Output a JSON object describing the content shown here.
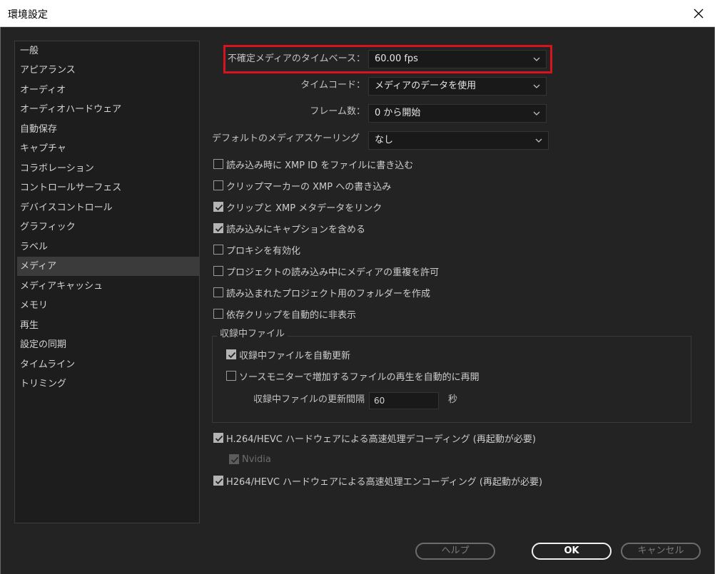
{
  "window": {
    "title": "環境設定"
  },
  "sidebar": {
    "items": [
      {
        "label": "一般"
      },
      {
        "label": "アピアランス"
      },
      {
        "label": "オーディオ"
      },
      {
        "label": "オーディオハードウェア"
      },
      {
        "label": "自動保存"
      },
      {
        "label": "キャプチャ"
      },
      {
        "label": "コラボレーション"
      },
      {
        "label": "コントロールサーフェス"
      },
      {
        "label": "デバイスコントロール"
      },
      {
        "label": "グラフィック"
      },
      {
        "label": "ラベル"
      },
      {
        "label": "メディア",
        "selected": true
      },
      {
        "label": "メディアキャッシュ"
      },
      {
        "label": "メモリ"
      },
      {
        "label": "再生"
      },
      {
        "label": "設定の同期"
      },
      {
        "label": "タイムライン"
      },
      {
        "label": "トリミング"
      }
    ]
  },
  "media": {
    "timebase": {
      "label": "不確定メディアのタイムベース：",
      "value": "60.00 fps"
    },
    "timecode": {
      "label": "タイムコード：",
      "value": "メディアのデータを使用"
    },
    "frame_count": {
      "label": "フレーム数：",
      "value": "0 から開始"
    },
    "scaling": {
      "label": "デフォルトのメディアスケーリング",
      "value": "なし"
    },
    "checkboxes": [
      {
        "label": "読み込み時に XMP ID をファイルに書き込む",
        "checked": false
      },
      {
        "label": "クリップマーカーの XMP への書き込み",
        "checked": false
      },
      {
        "label": "クリップと XMP メタデータをリンク",
        "checked": true
      },
      {
        "label": "読み込みにキャプションを含める",
        "checked": true
      },
      {
        "label": "プロキシを有効化",
        "checked": false
      },
      {
        "label": "プロジェクトの読み込み中にメディアの重複を許可",
        "checked": false
      },
      {
        "label": "読み込まれたプロジェクト用のフォルダーを作成",
        "checked": false
      },
      {
        "label": "依存クリップを自動的に非表示",
        "checked": false
      }
    ],
    "growing": {
      "title": "収録中ファイル",
      "auto_refresh": {
        "label": "収録中ファイルを自動更新",
        "checked": true
      },
      "resume_playback": {
        "label": "ソースモニターで増加するファイルの再生を自動的に再開",
        "checked": false
      },
      "interval_label": "収録中ファイルの更新間隔",
      "interval_value": "60",
      "interval_unit": "秒"
    },
    "hw_decode": {
      "label": "H.264/HEVC ハードウェアによる高速処理デコーディング (再起動が必要)",
      "checked": true
    },
    "nvidia": {
      "label": "Nvidia",
      "checked": true,
      "disabled": true
    },
    "hw_encode": {
      "label": "H264/HEVC ハードウェアによる高速処理エンコーディング (再起動が必要)",
      "checked": true
    }
  },
  "buttons": {
    "help": "ヘルプ",
    "ok": "OK",
    "cancel": "キャンセル"
  }
}
